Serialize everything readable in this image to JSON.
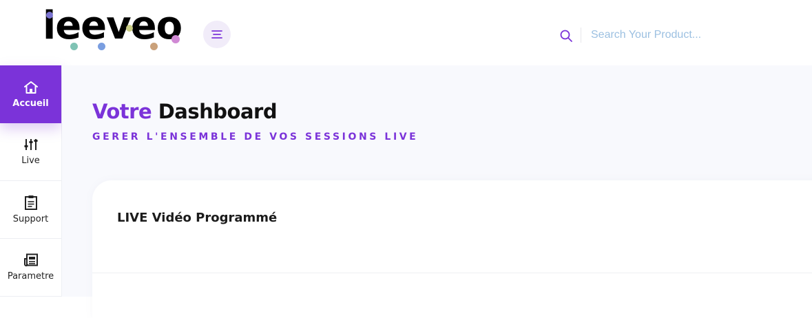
{
  "header": {
    "logo_text": "leeveo",
    "menu_icon": "menu-lines-icon",
    "search_icon": "search-icon",
    "search_placeholder": "Search Your Product...",
    "search_value": ""
  },
  "sidebar": {
    "items": [
      {
        "label": "Accueil",
        "icon": "home-icon",
        "active": true
      },
      {
        "label": "Live",
        "icon": "sliders-icon",
        "active": false
      },
      {
        "label": "Support",
        "icon": "clipboard-icon",
        "active": false
      },
      {
        "label": "Parametre",
        "icon": "newspaper-icon",
        "active": false
      }
    ]
  },
  "main": {
    "title_accent": "Votre",
    "title_rest": "Dashboard",
    "subtitle": "GERER L'ENSEMBLE DE VOS SESSIONS LIVE",
    "card": {
      "title": "LIVE Vidéo Programmé"
    }
  },
  "colors": {
    "brand": "#7b33d9",
    "background": "#f8f9fd",
    "search_placeholder": "#9cc0e1",
    "logo_dots": [
      "#7a73d0",
      "#7fc3b4",
      "#7a9ee0",
      "#c9cc84",
      "#caa17a",
      "#d089d4"
    ]
  }
}
